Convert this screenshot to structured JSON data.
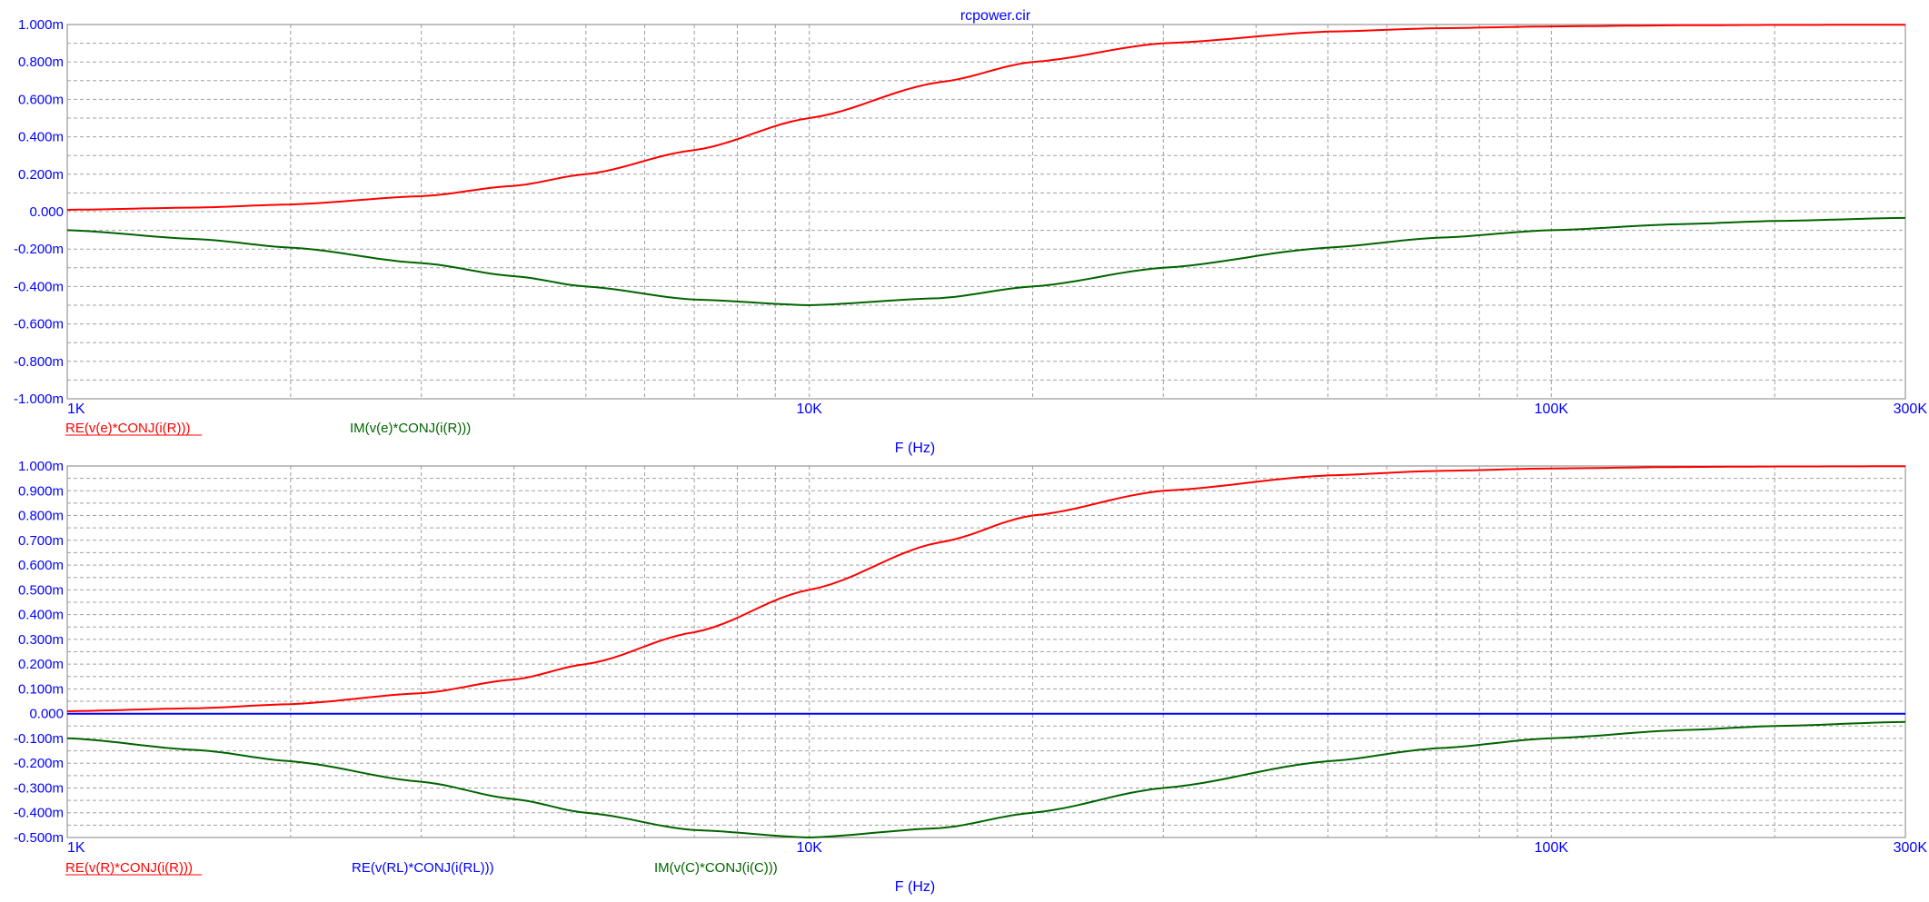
{
  "chart_data": [
    {
      "type": "line",
      "title": "rcpower.cir",
      "xlabel": "F (Hz)",
      "xscale": "log",
      "xlim": [
        1000,
        300000
      ],
      "xticks": [
        {
          "v": 1000,
          "label": "1K"
        },
        {
          "v": 10000,
          "label": "10K"
        },
        {
          "v": 100000,
          "label": "100K"
        },
        {
          "v": 300000,
          "label": "300K"
        }
      ],
      "ylim": [
        -0.001,
        0.001
      ],
      "ystep": 0.0002,
      "ylabels": [
        "1.000m",
        "0.800m",
        "0.600m",
        "0.400m",
        "0.200m",
        "0.000",
        "-0.200m",
        "-0.400m",
        "-0.600m",
        "-0.800m",
        "-1.000m"
      ],
      "grid": true,
      "legend_placement": "bottom-left",
      "series": [
        {
          "name": "RE(v(e)*CONJ(i(R)))",
          "color": "#ff0000",
          "x": [
            1000,
            1500,
            2000,
            3000,
            4000,
            5000,
            7000,
            10000,
            15000,
            20000,
            30000,
            50000,
            70000,
            100000,
            150000,
            200000,
            300000
          ],
          "y": [
            9.9e-06,
            2.2e-05,
            3.85e-05,
            8.26e-05,
            0.000138,
            0.0002,
            0.000329,
            0.0005,
            0.000692,
            0.0008,
            0.0009,
            0.000962,
            0.00098,
            0.00099,
            0.000996,
            0.000998,
            0.000999
          ]
        },
        {
          "name": "IM(v(e)*CONJ(i(R)))",
          "color": "#006400",
          "x": [
            1000,
            1500,
            2000,
            3000,
            4000,
            5000,
            7000,
            10000,
            15000,
            20000,
            30000,
            50000,
            70000,
            100000,
            150000,
            200000,
            300000
          ],
          "y": [
            -9.9e-05,
            -0.000147,
            -0.000192,
            -0.000275,
            -0.000345,
            -0.0004,
            -0.00047,
            -0.0005,
            -0.000462,
            -0.0004,
            -0.0003,
            -0.000192,
            -0.00014,
            -9.9e-05,
            -6.64e-05,
            -4.99e-05,
            -3.33e-05
          ]
        }
      ]
    },
    {
      "type": "line",
      "title": "",
      "xlabel": "F (Hz)",
      "xscale": "log",
      "xlim": [
        1000,
        300000
      ],
      "xticks": [
        {
          "v": 1000,
          "label": "1K"
        },
        {
          "v": 10000,
          "label": "10K"
        },
        {
          "v": 100000,
          "label": "100K"
        },
        {
          "v": 300000,
          "label": "300K"
        }
      ],
      "ylim": [
        -0.0005,
        0.001
      ],
      "ystep": 0.0001,
      "ylabels": [
        "1.000m",
        "0.900m",
        "0.800m",
        "0.700m",
        "0.600m",
        "0.500m",
        "0.400m",
        "0.300m",
        "0.200m",
        "0.100m",
        "0.000",
        "-0.100m",
        "-0.200m",
        "-0.300m",
        "-0.400m",
        "-0.500m"
      ],
      "grid": true,
      "legend_placement": "bottom-left",
      "series": [
        {
          "name": "RE(v(R)*CONJ(i(R)))",
          "color": "#ff0000",
          "x": [
            1000,
            1500,
            2000,
            3000,
            4000,
            5000,
            7000,
            10000,
            15000,
            20000,
            30000,
            50000,
            70000,
            100000,
            150000,
            200000,
            300000
          ],
          "y": [
            9.9e-06,
            2.2e-05,
            3.85e-05,
            8.26e-05,
            0.000138,
            0.0002,
            0.000329,
            0.0005,
            0.000692,
            0.0008,
            0.0009,
            0.000962,
            0.00098,
            0.00099,
            0.000996,
            0.000998,
            0.000999
          ]
        },
        {
          "name": "RE(v(RL)*CONJ(i(RL)))",
          "color": "#0000ff",
          "x": [
            1000,
            300000
          ],
          "y": [
            0,
            0
          ]
        },
        {
          "name": "IM(v(C)*CONJ(i(C)))",
          "color": "#006400",
          "x": [
            1000,
            1500,
            2000,
            3000,
            4000,
            5000,
            7000,
            10000,
            15000,
            20000,
            30000,
            50000,
            70000,
            100000,
            150000,
            200000,
            300000
          ],
          "y": [
            -9.9e-05,
            -0.000147,
            -0.000192,
            -0.000275,
            -0.000345,
            -0.0004,
            -0.00047,
            -0.0005,
            -0.000462,
            -0.0004,
            -0.0003,
            -0.000192,
            -0.00014,
            -9.9e-05,
            -6.64e-05,
            -4.99e-05,
            -3.33e-05
          ]
        }
      ]
    }
  ]
}
